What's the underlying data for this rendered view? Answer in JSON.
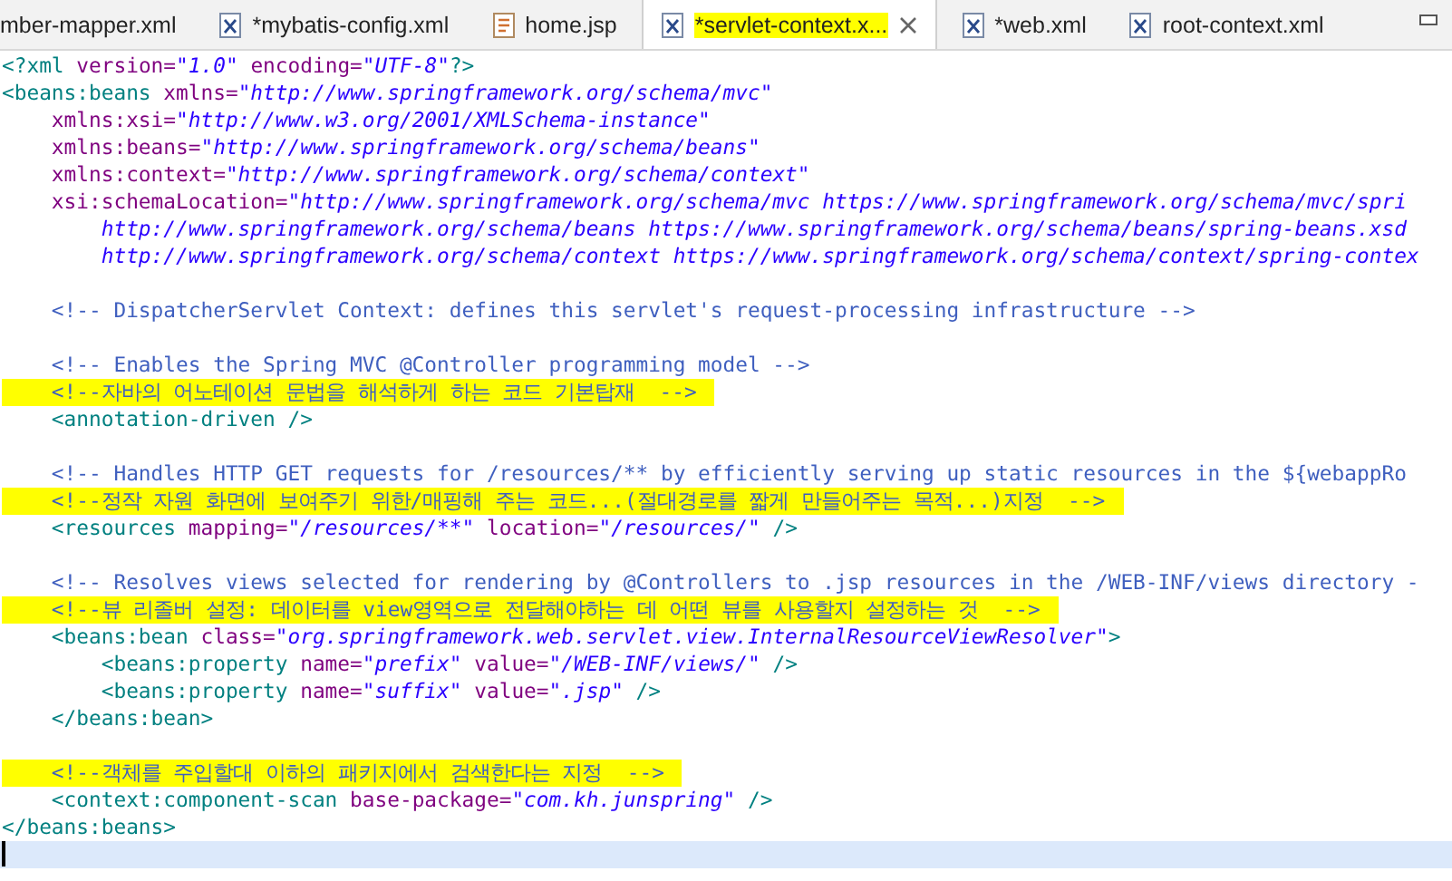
{
  "tabs": [
    {
      "label": "mber-mapper.xml",
      "kind": "plain",
      "selected": false,
      "highlighted": false,
      "closable": false
    },
    {
      "label": "*mybatis-config.xml",
      "kind": "xml",
      "selected": false,
      "highlighted": false,
      "closable": false
    },
    {
      "label": "home.jsp",
      "kind": "jsp",
      "selected": false,
      "highlighted": false,
      "closable": false
    },
    {
      "label": "*servlet-context.x...",
      "kind": "xml",
      "selected": true,
      "highlighted": true,
      "closable": true
    },
    {
      "label": "*web.xml",
      "kind": "xml",
      "selected": false,
      "highlighted": false,
      "closable": false
    },
    {
      "label": "root-context.xml",
      "kind": "xml",
      "selected": false,
      "highlighted": false,
      "closable": false
    }
  ],
  "editor": {
    "lines": [
      {
        "highlighted": false,
        "current": false,
        "tokens": [
          {
            "kind": "tag",
            "text": "<?xml "
          },
          {
            "kind": "attr",
            "text": "version="
          },
          {
            "kind": "value",
            "text": "\"1.0\" "
          },
          {
            "kind": "attr",
            "text": "encoding="
          },
          {
            "kind": "value",
            "text": "\"UTF-8\""
          },
          {
            "kind": "tag",
            "text": "?>"
          }
        ]
      },
      {
        "highlighted": false,
        "current": false,
        "tokens": [
          {
            "kind": "tag",
            "text": "<beans:beans "
          },
          {
            "kind": "attr",
            "text": "xmlns="
          },
          {
            "kind": "value",
            "text": "\"http://www.springframework.org/schema/mvc\""
          }
        ]
      },
      {
        "highlighted": false,
        "current": false,
        "tokens": [
          {
            "kind": "attr",
            "text": "    xmlns:xsi="
          },
          {
            "kind": "value",
            "text": "\"http://www.w3.org/2001/XMLSchema-instance\""
          }
        ]
      },
      {
        "highlighted": false,
        "current": false,
        "tokens": [
          {
            "kind": "attr",
            "text": "    xmlns:beans="
          },
          {
            "kind": "value",
            "text": "\"http://www.springframework.org/schema/beans\""
          }
        ]
      },
      {
        "highlighted": false,
        "current": false,
        "tokens": [
          {
            "kind": "attr",
            "text": "    xmlns:context="
          },
          {
            "kind": "value",
            "text": "\"http://www.springframework.org/schema/context\""
          }
        ]
      },
      {
        "highlighted": false,
        "current": false,
        "tokens": [
          {
            "kind": "attr",
            "text": "    xsi:schemaLocation="
          },
          {
            "kind": "value",
            "text": "\"http://www.springframework.org/schema/mvc https://www.springframework.org/schema/mvc/spri"
          }
        ]
      },
      {
        "highlighted": false,
        "current": false,
        "tokens": [
          {
            "kind": "value",
            "text": "        http://www.springframework.org/schema/beans https://www.springframework.org/schema/beans/spring-beans.xsd"
          }
        ]
      },
      {
        "highlighted": false,
        "current": false,
        "tokens": [
          {
            "kind": "value",
            "text": "        http://www.springframework.org/schema/context https://www.springframework.org/schema/context/spring-contex"
          }
        ]
      },
      {
        "highlighted": false,
        "current": false
      },
      {
        "highlighted": false,
        "current": false,
        "tokens": [
          {
            "kind": "comment",
            "text": "    <!-- DispatcherServlet Context: defines this servlet's request-processing infrastructure -->"
          }
        ]
      },
      {
        "highlighted": false,
        "current": false
      },
      {
        "highlighted": false,
        "current": false,
        "tokens": [
          {
            "kind": "comment",
            "text": "    <!-- Enables the Spring MVC @Controller programming model -->"
          }
        ]
      },
      {
        "highlighted": true,
        "current": false,
        "tokens": [
          {
            "kind": "comment",
            "text": "    <!--자바의 어노테이션 문법을 해석하게 하는 코드 기본탑재  -->"
          }
        ]
      },
      {
        "highlighted": false,
        "current": false,
        "tokens": [
          {
            "kind": "tag",
            "text": "    <annotation-driven />"
          }
        ]
      },
      {
        "highlighted": false,
        "current": false
      },
      {
        "highlighted": false,
        "current": false,
        "tokens": [
          {
            "kind": "comment",
            "text": "    <!-- Handles HTTP GET requests for /resources/** by efficiently serving up static resources in the ${webappRo"
          }
        ]
      },
      {
        "highlighted": true,
        "current": false,
        "tokens": [
          {
            "kind": "comment",
            "text": "    <!--정작 자원 화면에 보여주기 위한/매핑해 주는 코드...(절대경로를 짧게 만들어주는 목적...)지정  -->"
          }
        ]
      },
      {
        "highlighted": false,
        "current": false,
        "tokens": [
          {
            "kind": "tag",
            "text": "    <resources "
          },
          {
            "kind": "attr",
            "text": "mapping="
          },
          {
            "kind": "value",
            "text": "\"/resources/**\" "
          },
          {
            "kind": "attr",
            "text": "location="
          },
          {
            "kind": "value",
            "text": "\"/resources/\""
          },
          {
            "kind": "tag",
            "text": " />"
          }
        ]
      },
      {
        "highlighted": false,
        "current": false
      },
      {
        "highlighted": false,
        "current": false,
        "tokens": [
          {
            "kind": "comment",
            "text": "    <!-- Resolves views selected for rendering by @Controllers to .jsp resources in the /WEB-INF/views directory -"
          }
        ]
      },
      {
        "highlighted": true,
        "current": false,
        "tokens": [
          {
            "kind": "comment",
            "text": "    <!--뷰 리졸버 설정: 데이터를 view영역으로 전달해야하는 데 어떤 뷰를 사용할지 설정하는 것  -->"
          }
        ]
      },
      {
        "highlighted": false,
        "current": false,
        "tokens": [
          {
            "kind": "tag",
            "text": "    <beans:bean "
          },
          {
            "kind": "attr",
            "text": "class="
          },
          {
            "kind": "value",
            "text": "\"org.springframework.web.servlet.view.InternalResourceViewResolver\""
          },
          {
            "kind": "tag",
            "text": ">"
          }
        ]
      },
      {
        "highlighted": false,
        "current": false,
        "tokens": [
          {
            "kind": "tag",
            "text": "        <beans:property "
          },
          {
            "kind": "attr",
            "text": "name="
          },
          {
            "kind": "value",
            "text": "\"prefix\" "
          },
          {
            "kind": "attr",
            "text": "value="
          },
          {
            "kind": "value",
            "text": "\"/WEB-INF/views/\""
          },
          {
            "kind": "tag",
            "text": " />"
          }
        ]
      },
      {
        "highlighted": false,
        "current": false,
        "tokens": [
          {
            "kind": "tag",
            "text": "        <beans:property "
          },
          {
            "kind": "attr",
            "text": "name="
          },
          {
            "kind": "value",
            "text": "\"suffix\" "
          },
          {
            "kind": "attr",
            "text": "value="
          },
          {
            "kind": "value",
            "text": "\".jsp\""
          },
          {
            "kind": "tag",
            "text": " />"
          }
        ]
      },
      {
        "highlighted": false,
        "current": false,
        "tokens": [
          {
            "kind": "tag",
            "text": "    </beans:bean>"
          }
        ]
      },
      {
        "highlighted": false,
        "current": false
      },
      {
        "highlighted": true,
        "current": false,
        "tokens": [
          {
            "kind": "comment",
            "text": "    <!--객체를 주입할대 이하의 패키지에서 검색한다는 지정  -->"
          }
        ]
      },
      {
        "highlighted": false,
        "current": false,
        "tokens": [
          {
            "kind": "tag",
            "text": "    <context:component-scan "
          },
          {
            "kind": "attr",
            "text": "base-package="
          },
          {
            "kind": "value",
            "text": "\"com.kh.junspring\""
          },
          {
            "kind": "tag",
            "text": " />"
          }
        ]
      },
      {
        "highlighted": false,
        "current": false,
        "tokens": [
          {
            "kind": "tag",
            "text": "</beans:beans>"
          }
        ]
      },
      {
        "highlighted": false,
        "current": true
      }
    ]
  }
}
